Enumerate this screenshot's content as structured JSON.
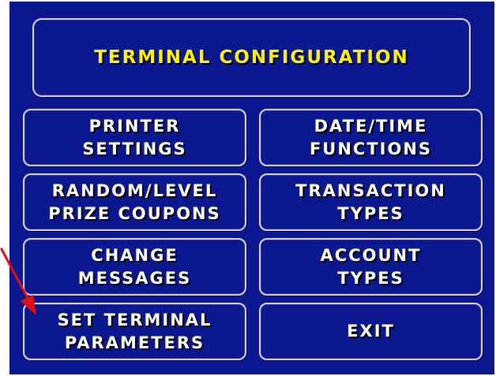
{
  "screen": {
    "title": "TERMINAL CONFIGURATION"
  },
  "buttons": {
    "printer_settings": {
      "line1": "PRINTER",
      "line2": "SETTINGS"
    },
    "date_time_functions": {
      "line1": "DATE/TIME",
      "line2": "FUNCTIONS"
    },
    "random_level_prize_coupons": {
      "line1": "RANDOM/LEVEL",
      "line2": "PRIZE COUPONS"
    },
    "transaction_types": {
      "line1": "TRANSACTION",
      "line2": "TYPES"
    },
    "change_messages": {
      "line1": "CHANGE",
      "line2": "MESSAGES"
    },
    "account_types": {
      "line1": "ACCOUNT",
      "line2": "TYPES"
    },
    "set_terminal_parameters": {
      "line1": "SET TERMINAL",
      "line2": "PARAMETERS"
    },
    "exit": {
      "label": "EXIT"
    }
  },
  "colors": {
    "screen_background": "#0c1890",
    "title_text": "#fff200",
    "button_text": "#ffffff",
    "border": "#d8d8e8",
    "annotation_arrow": "#e01010"
  },
  "icons": {
    "annotation": "arrow-pointer-icon"
  }
}
